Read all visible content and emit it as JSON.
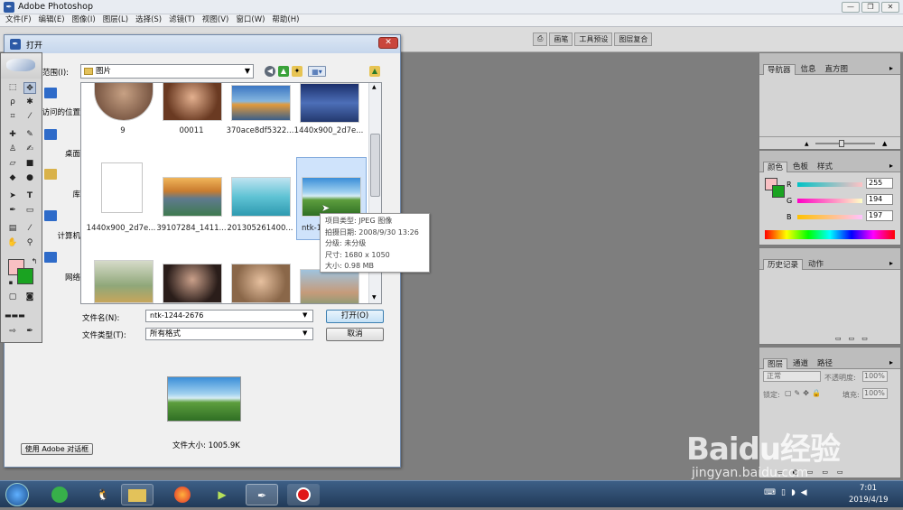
{
  "app": {
    "title": "Adobe Photoshop"
  },
  "menu": [
    "文件(F)",
    "编辑(E)",
    "图像(I)",
    "图层(L)",
    "选择(S)",
    "滤镜(T)",
    "视图(V)",
    "窗口(W)",
    "帮助(H)"
  ],
  "palette_well": [
    "画笔",
    "工具预设",
    "图层复合"
  ],
  "dialog": {
    "title": "打开",
    "lookin_label": "范围(I):",
    "lookin_value": "图片",
    "places": [
      "访问的位置",
      "桌面",
      "库",
      "计算机",
      "网络"
    ],
    "files": [
      {
        "name": "9"
      },
      {
        "name": "00011"
      },
      {
        "name": "370ace8df5322..."
      },
      {
        "name": "1440x900_2d7e..."
      },
      {
        "name": "1440x900_2d7e..."
      },
      {
        "name": "39107284_1411..."
      },
      {
        "name": "201305261400..."
      },
      {
        "name": "ntk-12"
      },
      {
        "name": ""
      },
      {
        "name": ""
      },
      {
        "name": ""
      },
      {
        "name": ""
      }
    ],
    "tooltip": [
      "项目类型: JPEG 图像",
      "拍摄日期: 2008/9/30 13:26",
      "分级: 未分级",
      "尺寸: 1680 x 1050",
      "大小: 0.98 MB"
    ],
    "filename_label": "文件名(N):",
    "filename_value": "ntk-1244-2676",
    "filetype_label": "文件类型(T):",
    "filetype_value": "所有格式",
    "open_button": "打开(O)",
    "cancel_button": "取消",
    "filesize": "文件大小: 1005.9K",
    "adobe_dialog_button": "使用 Adobe 对话框"
  },
  "panels": {
    "navigator_tabs": [
      "导航器",
      "信息",
      "直方图"
    ],
    "color_tabs": [
      "颜色",
      "色板",
      "样式"
    ],
    "color_sliders": [
      {
        "label": "R",
        "value": "255"
      },
      {
        "label": "G",
        "value": "194"
      },
      {
        "label": "B",
        "value": "197"
      }
    ],
    "history_tabs": [
      "历史记录",
      "动作"
    ],
    "layers_tabs": [
      "图层",
      "通道",
      "路径"
    ],
    "blend_mode": "正常",
    "opacity_label": "不透明度:",
    "opacity_value": "100%",
    "lock_label": "锁定:",
    "fill_label": "填充:",
    "fill_value": "100%"
  },
  "colors": {
    "foreground": "#f8c0c3",
    "background": "#1aa321"
  },
  "taskbar": {
    "time": "7:01",
    "date": "2019/4/19"
  },
  "watermark": {
    "brand": "Baidu经验",
    "url": "jingyan.baidu.com"
  }
}
